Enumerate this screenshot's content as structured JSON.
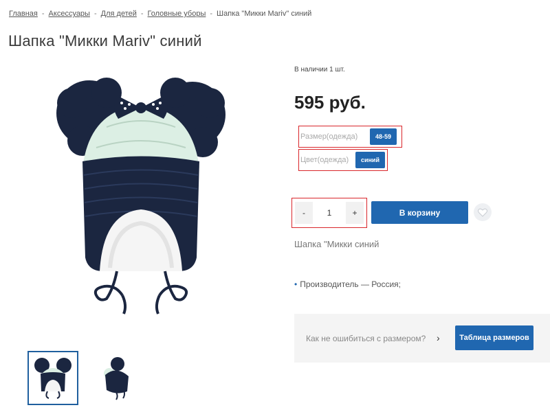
{
  "breadcrumb": {
    "items": [
      "Главная",
      "Аксессуары",
      "Для детей",
      "Головные уборы"
    ],
    "current": "Шапка \"Микки Mariv\" синий",
    "separator": "-"
  },
  "product": {
    "title": "Шапка \"Микки Mariv\" синий",
    "stock": "В наличии 1 шт.",
    "price": "595 руб.",
    "properties": {
      "size": {
        "label": "Размер(одежда)",
        "value": "48-59"
      },
      "color": {
        "label": "Цвет(одежда)",
        "value": "синий"
      }
    },
    "quantity": {
      "value": "1",
      "minus": "-",
      "plus": "+"
    },
    "add_to_cart": "В корзину",
    "description": "Шапка \"Микки   синий",
    "specs": [
      "Производитель — Россия;"
    ]
  },
  "size_help": {
    "question": "Как не ошибиться с размером?",
    "arrow": "›",
    "button": "Таблица размеров"
  },
  "icons": {
    "favorite": "heart-icon",
    "size_help_arrow": "chevron-right-icon"
  },
  "colors": {
    "accent": "#2067b0",
    "hat_dark": "#1b2640",
    "hat_light": "#dcefe4",
    "highlight_border": "#d9252a"
  }
}
